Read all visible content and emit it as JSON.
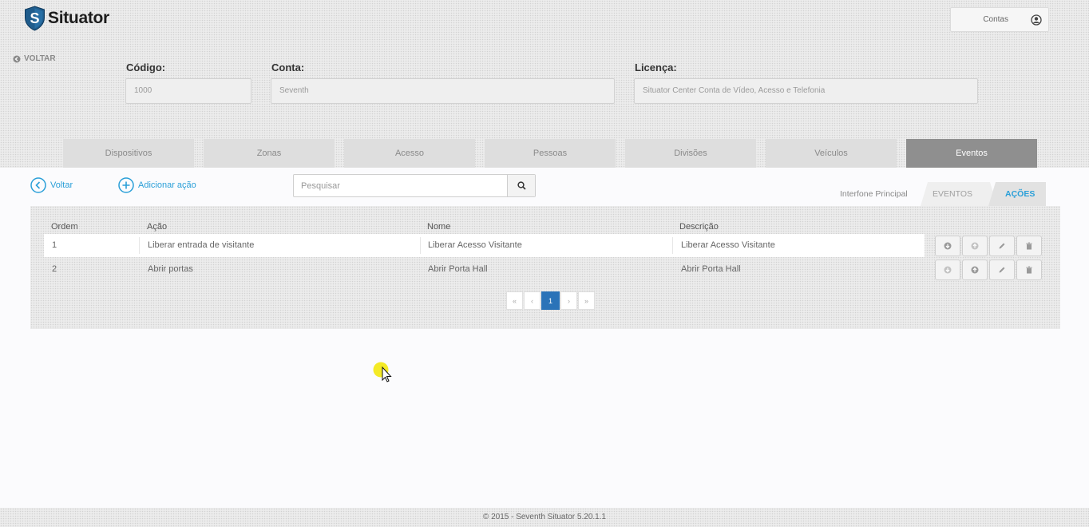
{
  "app": {
    "name": "Situator",
    "accounts_label": "Contas"
  },
  "nav": {
    "back_label": "VOLTAR"
  },
  "form": {
    "codigo": {
      "label": "Código:",
      "value": "1000"
    },
    "conta": {
      "label": "Conta:",
      "value": "Seventh"
    },
    "licenca": {
      "label": "Licença:",
      "value": "Situator Center Conta de Vídeo, Acesso e Telefonia"
    }
  },
  "tabs": [
    {
      "label": "Dispositivos"
    },
    {
      "label": "Zonas"
    },
    {
      "label": "Acesso"
    },
    {
      "label": "Pessoas"
    },
    {
      "label": "Divisões"
    },
    {
      "label": "Veículos"
    },
    {
      "label": "Eventos",
      "active": true
    }
  ],
  "toolbar": {
    "back_label": "Voltar",
    "add_label": "Adicionar ação",
    "search_placeholder": "Pesquisar"
  },
  "subtabs": {
    "context": "Interfone Principal",
    "events": "EVENTOS",
    "actions": "AÇÕES"
  },
  "table": {
    "headers": [
      "Ordem",
      "Ação",
      "Nome",
      "Descrição"
    ],
    "rows": [
      {
        "ordem": "1",
        "acao": "Liberar entrada de visitante",
        "nome": "Liberar Acesso Visitante",
        "descricao": "Liberar Acesso Visitante"
      },
      {
        "ordem": "2",
        "acao": "Abrir portas",
        "nome": "Abrir Porta Hall",
        "descricao": "Abrir Porta Hall"
      }
    ]
  },
  "pagination": {
    "first": "«",
    "prev": "‹",
    "current": "1",
    "next": "›",
    "last": "»"
  },
  "footer": {
    "text": "© 2015 - Seventh Situator 5.20.1.1"
  },
  "colors": {
    "accent": "#2a9fd8",
    "page_active": "#2b73b8",
    "tab_active": "#8f8f8f",
    "logo_blue": "#1f5c8c"
  }
}
